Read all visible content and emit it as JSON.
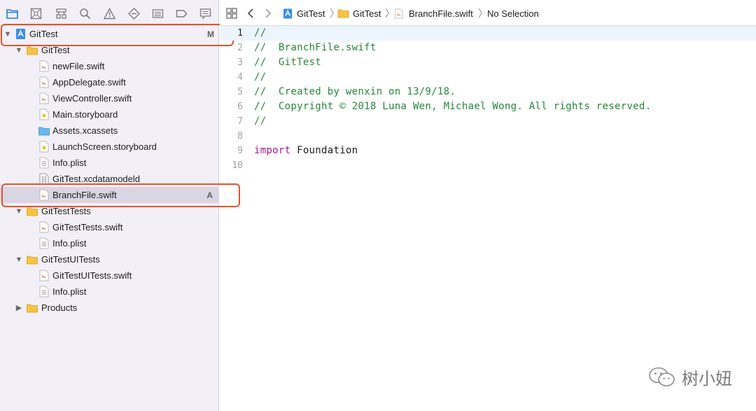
{
  "navigator": {
    "tree": [
      {
        "label": "GitTest",
        "badge": "M",
        "type": "project"
      },
      {
        "label": "GitTest",
        "type": "folder"
      },
      {
        "label": "newFile.swift",
        "type": "swift"
      },
      {
        "label": "AppDelegate.swift",
        "type": "swift"
      },
      {
        "label": "ViewController.swift",
        "type": "swift"
      },
      {
        "label": "Main.storyboard",
        "type": "storyboard"
      },
      {
        "label": "Assets.xcassets",
        "type": "assets"
      },
      {
        "label": "LaunchScreen.storyboard",
        "type": "storyboard"
      },
      {
        "label": "Info.plist",
        "type": "plist"
      },
      {
        "label": "GitTest.xcdatamodeld",
        "type": "datamodel"
      },
      {
        "label": "BranchFile.swift",
        "badge": "A",
        "type": "swift",
        "selected": true
      },
      {
        "label": "GitTestTests",
        "type": "folder"
      },
      {
        "label": "GitTestTests.swift",
        "type": "swift"
      },
      {
        "label": "Info.plist",
        "type": "plist"
      },
      {
        "label": "GitTestUITests",
        "type": "folder"
      },
      {
        "label": "GitTestUITests.swift",
        "type": "swift"
      },
      {
        "label": "Info.plist",
        "type": "plist"
      },
      {
        "label": "Products",
        "type": "folder"
      }
    ]
  },
  "jumpbar": {
    "project": "GitTest",
    "group": "GitTest",
    "file": "BranchFile.swift",
    "selection": "No Selection"
  },
  "editor": {
    "current_line": 1,
    "lines": [
      {
        "num": "1",
        "text": "//",
        "kind": "comment"
      },
      {
        "num": "2",
        "text": "//  BranchFile.swift",
        "kind": "comment"
      },
      {
        "num": "3",
        "text": "//  GitTest",
        "kind": "comment"
      },
      {
        "num": "4",
        "text": "//",
        "kind": "comment"
      },
      {
        "num": "5",
        "text": "//  Created by wenxin on 13/9/18.",
        "kind": "comment"
      },
      {
        "num": "6",
        "text": "//  Copyright © 2018 Luna Wen, Michael Wong. All rights reserved.",
        "kind": "comment"
      },
      {
        "num": "7",
        "text": "//",
        "kind": "comment"
      },
      {
        "num": "8",
        "text": "",
        "kind": "plain"
      },
      {
        "num": "9",
        "keyword": "import",
        "rest": " Foundation",
        "kind": "import"
      },
      {
        "num": "10",
        "text": "",
        "kind": "plain"
      }
    ]
  },
  "watermark": {
    "text": "树小妞"
  },
  "colors": {
    "highlight_box": "#e2542c",
    "comment": "#26873a",
    "keyword": "#b0139d",
    "folder": "#f5c242",
    "accent": "#1f7ae0"
  }
}
